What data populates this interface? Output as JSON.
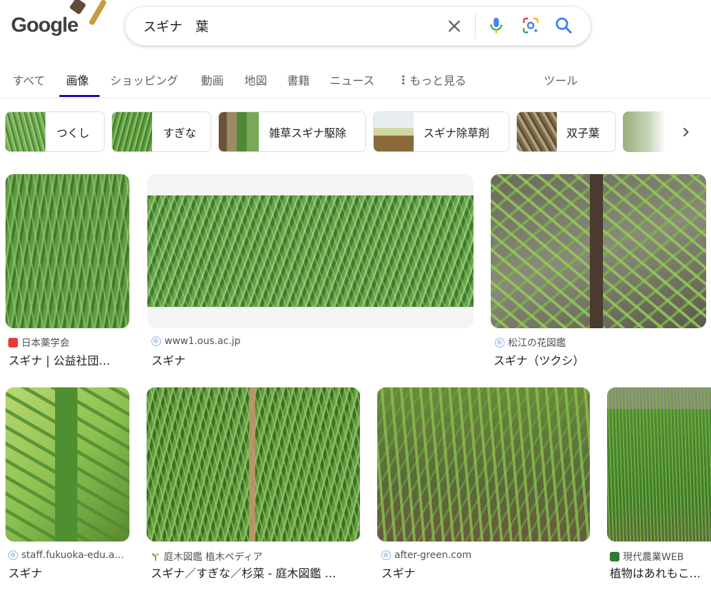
{
  "search": {
    "query": "スギナ　葉"
  },
  "logo": {
    "text": "Google"
  },
  "tabs": [
    {
      "label": "すべて"
    },
    {
      "label": "画像",
      "active": true
    },
    {
      "label": "ショッピング"
    },
    {
      "label": "動画"
    },
    {
      "label": "地図"
    },
    {
      "label": "書籍"
    },
    {
      "label": "ニュース"
    },
    {
      "label": "もっと見る"
    },
    {
      "label": "ツール"
    }
  ],
  "chips": [
    {
      "label": "つくし"
    },
    {
      "label": "すぎな"
    },
    {
      "label": "雑草スギナ駆除"
    },
    {
      "label": "スギナ除草剤"
    },
    {
      "label": "双子葉"
    }
  ],
  "results": [
    {
      "source": "日本薬学会",
      "title": "スギナ | 公益社団…"
    },
    {
      "source": "www1.ous.ac.jp",
      "title": "スギナ"
    },
    {
      "source": "松江の花図鑑",
      "title": "スギナ（ツクシ）"
    },
    {
      "source": "staff.fukuoka-edu.a…",
      "title": "スギナ"
    },
    {
      "source": "庭木図鑑 植木ペディア",
      "title": "スギナ／すぎな／杉菜 - 庭木図鑑 …"
    },
    {
      "source": "after-green.com",
      "title": "スギナ"
    },
    {
      "source": "現代農業WEB",
      "title": "植物はあれもこれ…"
    }
  ],
  "colors": {
    "accent_link": "#1a0dab",
    "google_blue": "#4285f4",
    "google_red": "#ea4335",
    "google_yellow": "#fbbc04",
    "google_green": "#34a853",
    "plant_green": "#5a9a3a"
  },
  "icons": {
    "clear": "close-icon",
    "voice": "mic-icon",
    "lens": "camera-lens-icon",
    "search": "search-icon",
    "more": "more-vert-icon",
    "next": "chevron-right-icon"
  }
}
